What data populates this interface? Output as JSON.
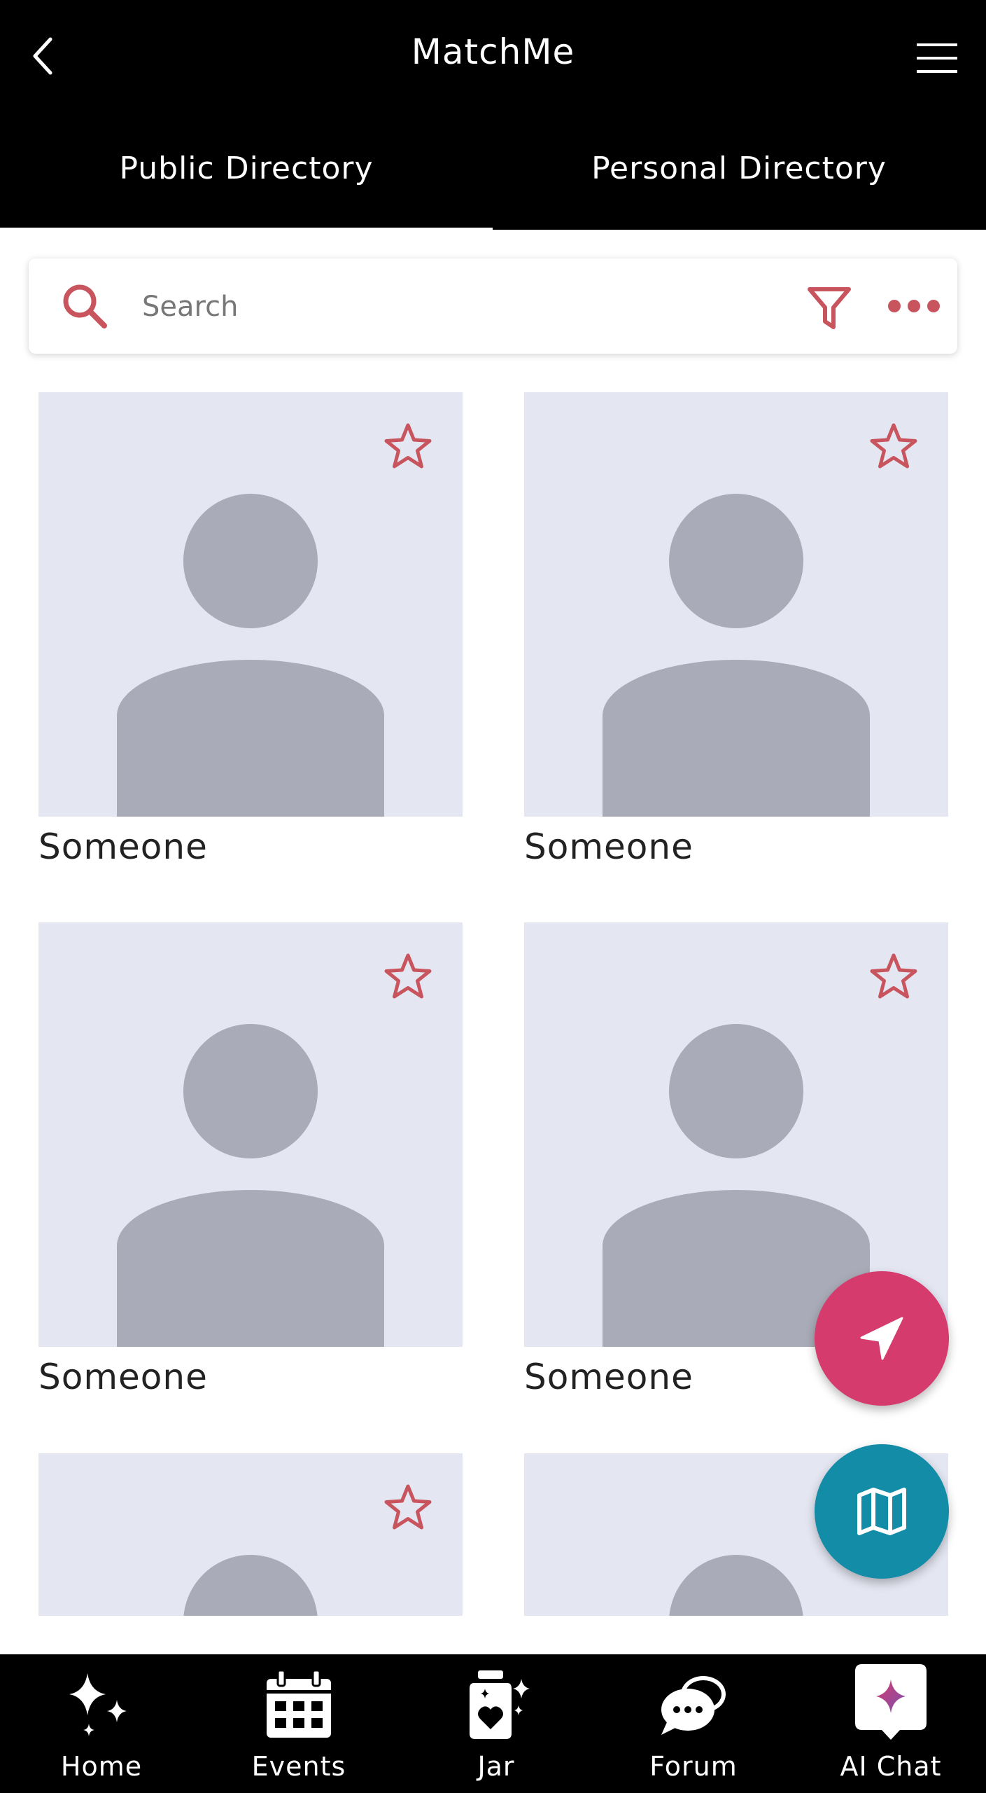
{
  "header": {
    "title": "MatchMe",
    "back_icon": "chevron-left-icon",
    "menu_icon": "hamburger-menu-icon"
  },
  "tabs": [
    {
      "label": "Public Directory",
      "active": true
    },
    {
      "label": "Personal Directory",
      "active": false
    }
  ],
  "search": {
    "placeholder": "Search",
    "value": "",
    "icons": [
      "search-icon",
      "filter-icon",
      "more-horizontal-icon"
    ]
  },
  "profiles": [
    {
      "name": "Someone",
      "favorite_icon": "star-outline-icon"
    },
    {
      "name": "Someone",
      "favorite_icon": "star-outline-icon"
    },
    {
      "name": "Someone",
      "favorite_icon": "star-outline-icon"
    },
    {
      "name": "Someone",
      "favorite_icon": "star-outline-icon"
    },
    {
      "name": "",
      "favorite_icon": "star-outline-icon"
    },
    {
      "name": "",
      "favorite_icon": ""
    }
  ],
  "fabs": [
    {
      "icon": "send-navigation-icon"
    },
    {
      "icon": "map-icon"
    }
  ],
  "bottom_nav": [
    {
      "label": "Home",
      "icon": "sparkles-icon"
    },
    {
      "label": "Events",
      "icon": "calendar-icon"
    },
    {
      "label": "Jar",
      "icon": "jar-heart-icon"
    },
    {
      "label": "Forum",
      "icon": "chat-bubbles-icon"
    },
    {
      "label": "AI Chat",
      "icon": "ai-chat-icon"
    }
  ],
  "colors": {
    "accent": "#c8545e",
    "send_fab": "#d63b6e",
    "map_fab": "#138ca8",
    "placeholder_bg": "#e4e6f2",
    "avatar": "#a9acb8"
  }
}
